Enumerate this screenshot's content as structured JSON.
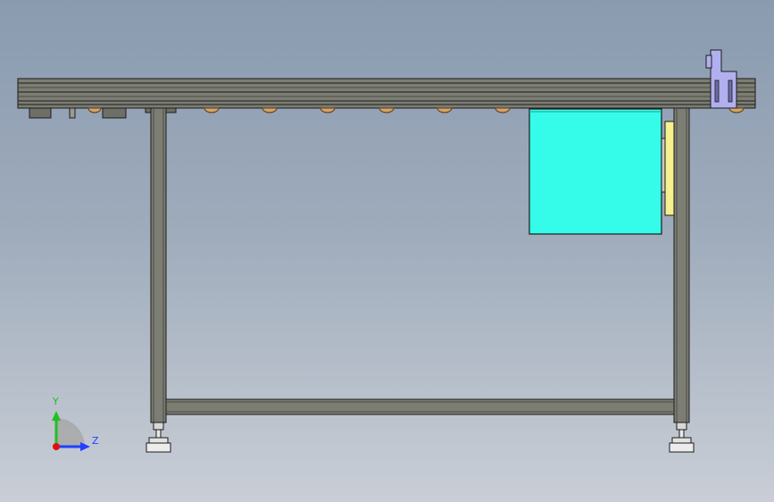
{
  "viewport": {
    "background_top": "#8a9bb0",
    "background_bottom": "#c9ced6"
  },
  "colors": {
    "frame": "#7c7d73",
    "frame_dark": "#5a5b52",
    "outline": "#1c1c1c",
    "cabinet": "#35fbe9",
    "panel": "#f7f08e",
    "bracket": "#b1b0ee",
    "roller": "#d4a46a",
    "foot": "#e2e2e2"
  },
  "triad": {
    "y_label": "Y",
    "z_label": "Z",
    "y_color": "#20c020",
    "z_color": "#2040ff",
    "x_color": "#e01010"
  }
}
